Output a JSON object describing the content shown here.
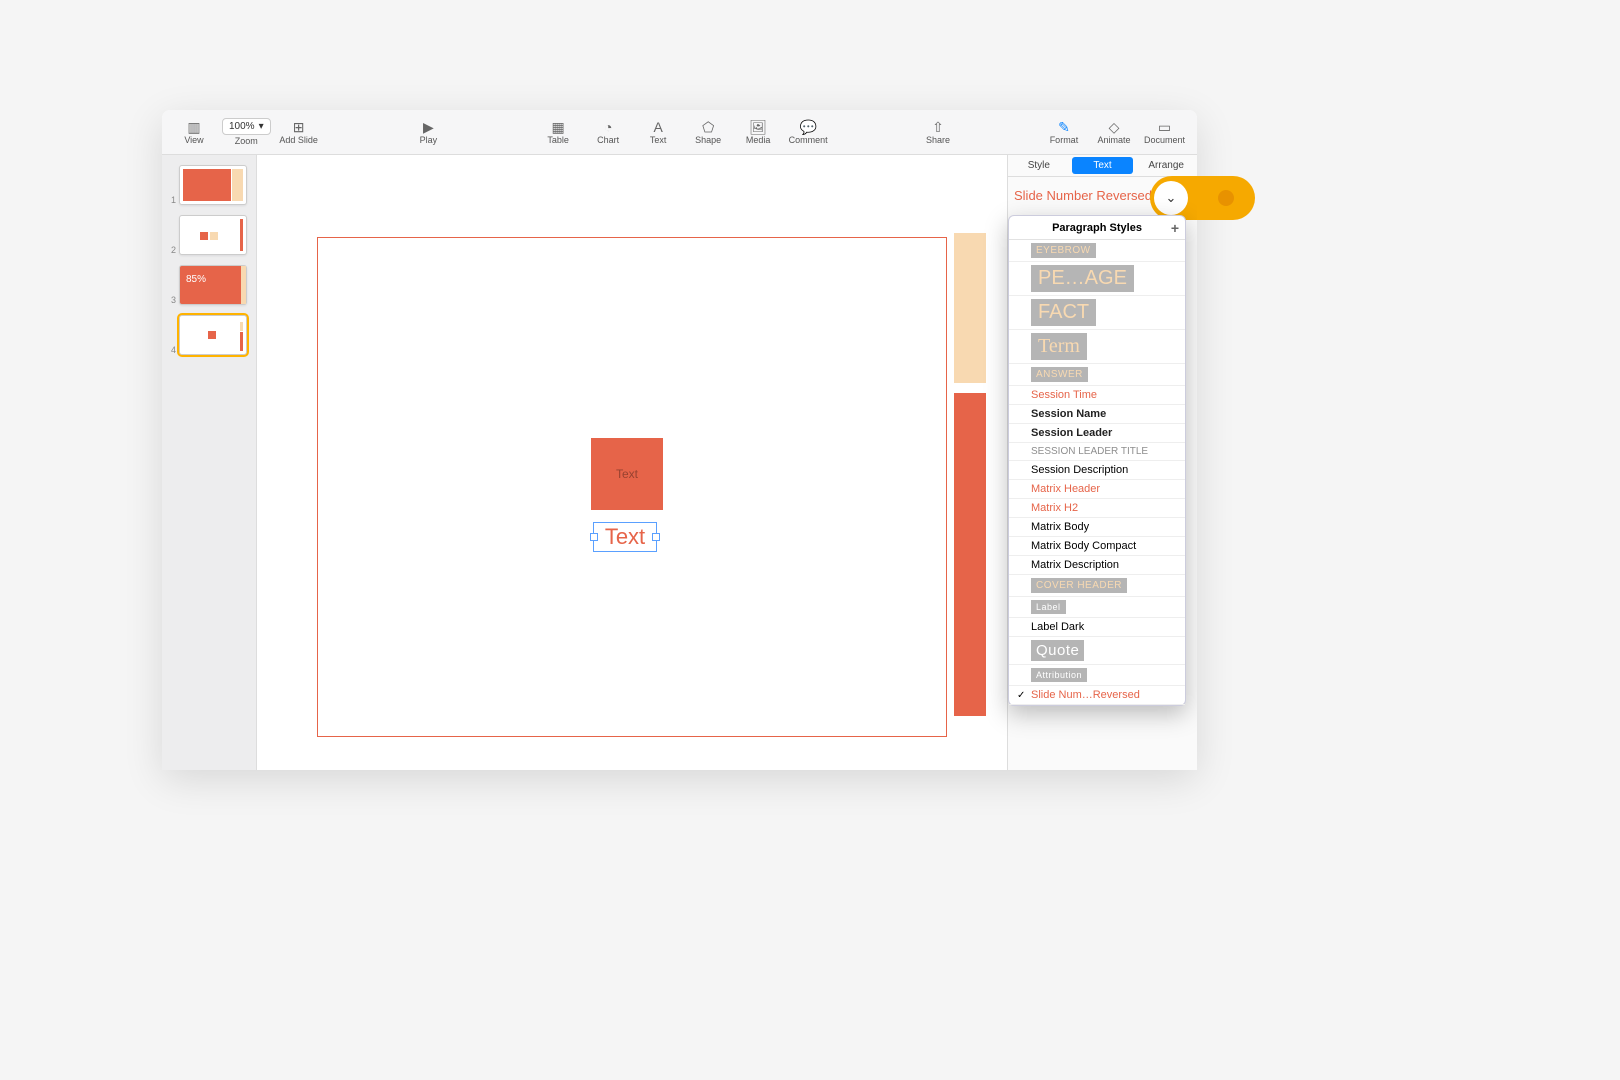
{
  "toolbar": {
    "view": "View",
    "zoom_label": "Zoom",
    "zoom_value": "100%",
    "add_slide": "Add Slide",
    "play": "Play",
    "table": "Table",
    "chart": "Chart",
    "text": "Text",
    "shape": "Shape",
    "media": "Media",
    "comment": "Comment",
    "share": "Share",
    "format": "Format",
    "animate": "Animate",
    "document": "Document"
  },
  "thumbs": [
    "1",
    "2",
    "3",
    "4"
  ],
  "thumb3_text": "85%",
  "canvas": {
    "square_text": "Text",
    "textbox_text": "Text"
  },
  "inspector": {
    "tabs": {
      "style": "Style",
      "text": "Text",
      "arrange": "Arrange"
    },
    "current_style": "Slide Number Reversed",
    "popover_title": "Paragraph Styles"
  },
  "styles": [
    {
      "label": "EYEBROW",
      "kind": "badge-cream-small"
    },
    {
      "label": "PE…AGE",
      "kind": "big-badge"
    },
    {
      "label": "FACT",
      "kind": "big-badge"
    },
    {
      "label": "Term",
      "kind": "big-badge-serif"
    },
    {
      "label": "ANSWER",
      "kind": "badge-cream-small"
    },
    {
      "label": "Session Time",
      "kind": "txt-red"
    },
    {
      "label": "Session Name",
      "kind": "txt-bold"
    },
    {
      "label": "Session Leader",
      "kind": "txt-bold"
    },
    {
      "label": "SESSION LEADER TITLE",
      "kind": "txt-grey-caps"
    },
    {
      "label": "Session Description",
      "kind": "txt"
    },
    {
      "label": "Matrix Header",
      "kind": "txt-red"
    },
    {
      "label": "Matrix H2",
      "kind": "txt-red"
    },
    {
      "label": "Matrix Body",
      "kind": "txt"
    },
    {
      "label": "Matrix Body Compact",
      "kind": "txt"
    },
    {
      "label": "Matrix Description",
      "kind": "txt"
    },
    {
      "label": "COVER HEADER",
      "kind": "badge-cream-small"
    },
    {
      "label": "Label",
      "kind": "badge-white-small"
    },
    {
      "label": "Label Dark",
      "kind": "txt"
    },
    {
      "label": "Quote",
      "kind": "badge-white-med"
    },
    {
      "label": "Attribution",
      "kind": "badge-white-small"
    },
    {
      "label": "Slide Num…Reversed",
      "kind": "txt-red",
      "checked": true
    }
  ]
}
